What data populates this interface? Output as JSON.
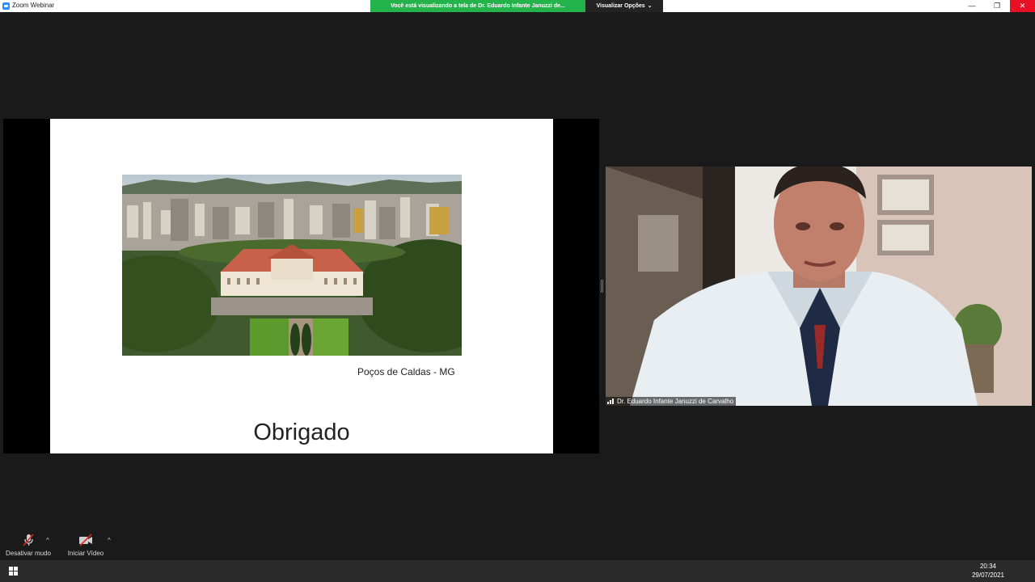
{
  "window": {
    "title": "Zoom Webinar",
    "share_banner": "Você está visualizando a tela de Dr. Eduardo Infante Januzzi de...",
    "view_options": "Visualizar Opções",
    "controls": {
      "minimize": "—",
      "restore": "❐",
      "close": "✕"
    }
  },
  "slide": {
    "caption": "Poços de Caldas - MG",
    "title": "Obrigado"
  },
  "video": {
    "participant_name": "Dr. Eduardo Infante Januzzi de Carvalho"
  },
  "toolbar": {
    "mute_label": "Desativar mudo",
    "video_label": "Iniciar Vídeo"
  },
  "taskbar": {
    "time": "20:34",
    "date": "29/07/2021"
  },
  "colors": {
    "banner": "#23b34a",
    "close": "#e81123",
    "background": "#1a1a1a"
  }
}
